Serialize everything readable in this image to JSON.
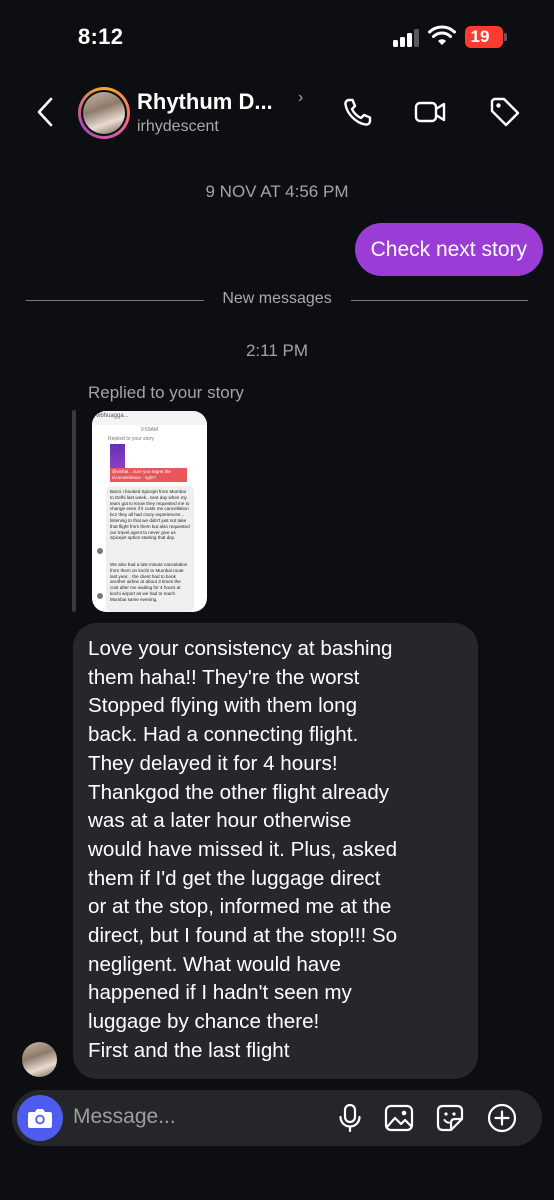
{
  "status_bar": {
    "time": "8:12",
    "battery": "19"
  },
  "header": {
    "name": "Rhythum D...",
    "username": "irhydescent"
  },
  "thread": {
    "timestamp_1": "9 NOV AT 4:56 PM",
    "outgoing_message": "Check next story",
    "new_messages_label": "New messages",
    "timestamp_2": "2:11 PM",
    "replied_label": "Replied to your story",
    "story_preview": {
      "username": "vibhuagga...",
      "time": "9:59AM",
      "label": "Replied to your story",
      "highlight": "@vishal... sure you regret the inconvenience - right?",
      "messages": [
        "Bacci I booked Spicejet from Mumbai to Delhi last week.. next day when my team got to know they requested me to change even if it costs me cancellation bcz they all had crazy experiences... listening to that we didn't just not take that flight from them but also requested our travel agent to never give us Spicejet option starting that day.",
        "We also had a last minute cancelation from them on kochi to Mumbai route last year... the client had to book another airline at about 3 times the cost after me waiting for 4 hours at kochi airport as we had to reach Mumbai same evening."
      ]
    },
    "incoming_lines": [
      "Love your consistency at bashing",
      "them haha!! They're the worst",
      "Stopped flying with them long",
      "back. Had a connecting flight.",
      "They delayed it for 4 hours!",
      "Thankgod the other flight already",
      "was at a later hour otherwise",
      "would have missed it. Plus, asked",
      "them if I'd get the luggage direct",
      "or at the stop, informed me at the",
      "direct, but I found at the stop!!! So",
      "negligent. What would have",
      "happened if I hadn't seen my",
      "luggage by chance there!",
      "First and the last flight"
    ]
  },
  "composer": {
    "placeholder": "Message..."
  },
  "icons": {
    "back": "chevron-left-icon",
    "call": "phone-icon",
    "video": "video-camera-icon",
    "tag": "tag-icon",
    "camera": "camera-icon",
    "mic": "microphone-icon",
    "gallery": "image-icon",
    "sticker": "sticker-icon",
    "add": "plus-circle-icon"
  },
  "colors": {
    "background": "#0d0e12",
    "outgoing_bubble": "#9b3cd6",
    "incoming_bubble": "#26272b",
    "camera_button": "#4f5cf0",
    "battery": "#ff3b30"
  }
}
